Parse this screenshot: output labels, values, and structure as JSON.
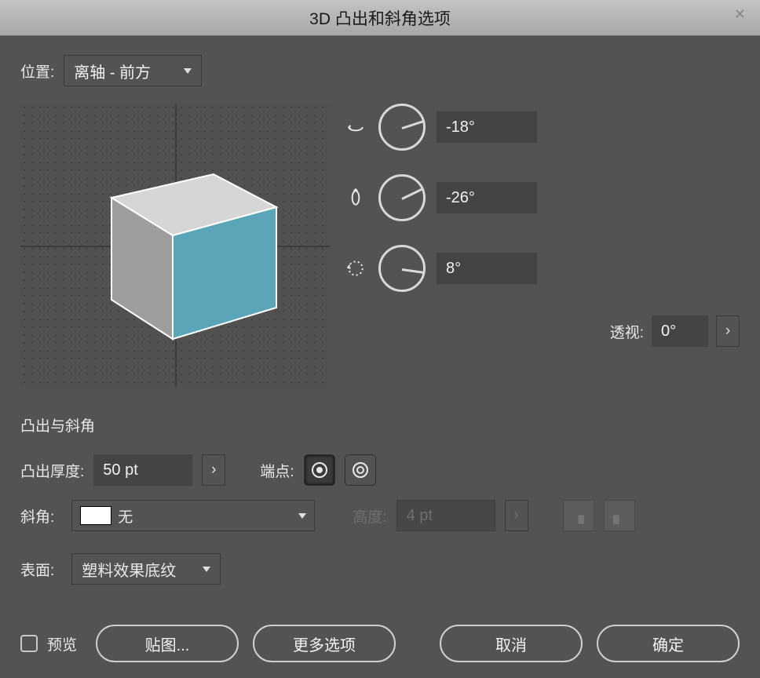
{
  "title": "3D 凸出和斜角选项",
  "position": {
    "label": "位置:",
    "value": "离轴 - 前方"
  },
  "rotation": {
    "x": {
      "value": "-18°",
      "angle": -18
    },
    "y": {
      "value": "-26°",
      "angle": -26
    },
    "z": {
      "value": "8°",
      "angle": 8
    }
  },
  "perspective": {
    "label": "透视:",
    "value": "0°"
  },
  "extrude": {
    "section_title": "凸出与斜角",
    "depth_label": "凸出厚度:",
    "depth_value": "50 pt",
    "cap_label": "端点:",
    "bevel_label": "斜角:",
    "bevel_value": "无",
    "height_label": "高度:",
    "height_value": "4 pt"
  },
  "surface": {
    "label": "表面:",
    "value": "塑料效果底纹"
  },
  "buttons": {
    "preview": "预览",
    "map_art": "贴图...",
    "more_options": "更多选项",
    "cancel": "取消",
    "ok": "确定"
  },
  "colors": {
    "cube_front": "#5aa6b8",
    "cube_side": "#9e9e9e",
    "cube_top": "#d6d6d6"
  }
}
